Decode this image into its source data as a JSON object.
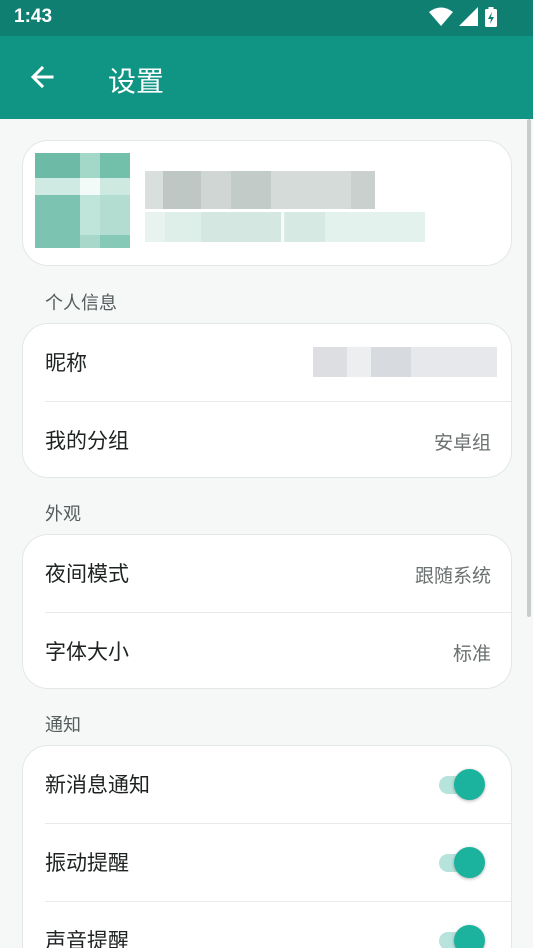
{
  "status": {
    "time": "1:43"
  },
  "header": {
    "title": "设置"
  },
  "sections": {
    "personal": {
      "title": "个人信息",
      "nickname_label": "昵称",
      "group_label": "我的分组",
      "group_value": "安卓组"
    },
    "appearance": {
      "title": "外观",
      "night_label": "夜间模式",
      "night_value": "跟随系统",
      "font_label": "字体大小",
      "font_value": "标准"
    },
    "notify": {
      "title": "通知",
      "new_msg_label": "新消息通知",
      "vibrate_label": "振动提醒",
      "sound_label": "声音提醒",
      "new_msg_on": true,
      "vibrate_on": true,
      "sound_on": true
    }
  },
  "colors": {
    "status_bar": "#0e7f71",
    "app_bar": "#109584",
    "toggle_thumb": "#1bb39d",
    "toggle_track": "#b6e3dc"
  }
}
